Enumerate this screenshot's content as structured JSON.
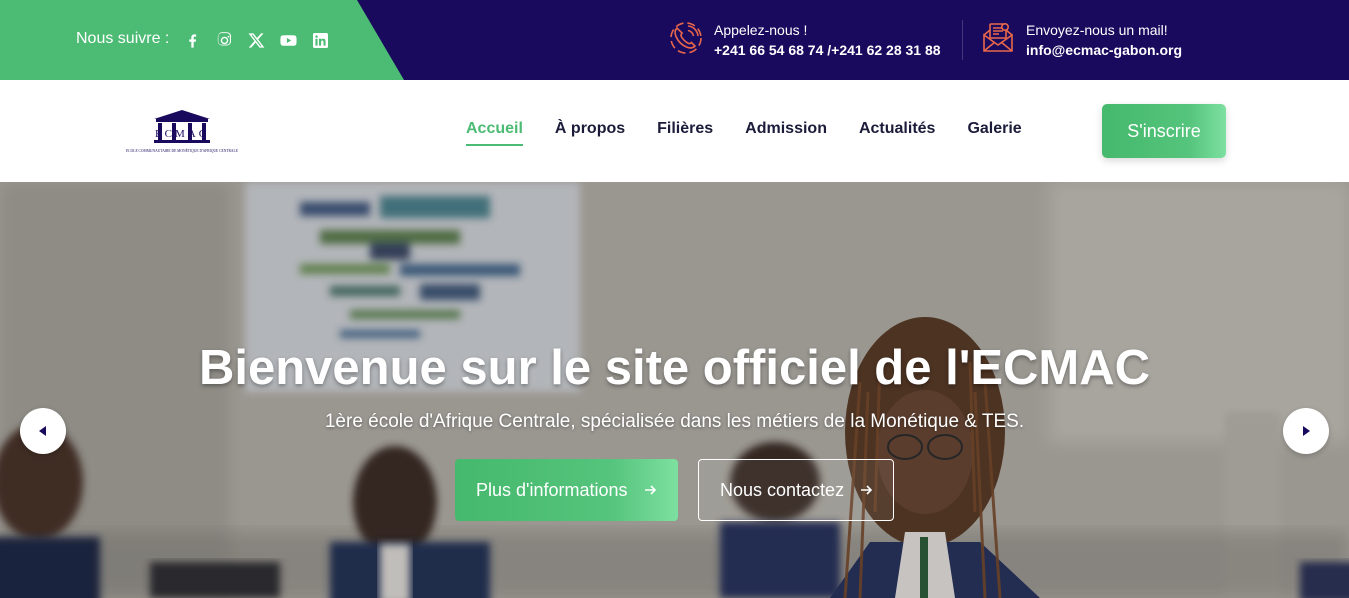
{
  "topbar": {
    "follow_label": "Nous suivre :",
    "socials": [
      {
        "icon": "facebook-icon"
      },
      {
        "icon": "instagram-icon"
      },
      {
        "icon": "x-twitter-icon"
      },
      {
        "icon": "youtube-icon"
      },
      {
        "icon": "linkedin-icon"
      }
    ],
    "phone": {
      "title": "Appelez-nous !",
      "value": "+241 66 54 68 74 /+241 62 28 31 88",
      "icon": "phone-icon"
    },
    "mail": {
      "title": "Envoyez-nous un mail!",
      "value": "info@ecmac-gabon.org",
      "icon": "mail-icon"
    }
  },
  "header": {
    "logo_text": "ECMAC",
    "logo_subtitle": "ECOLE COMMUNAUTAIRE DE MONÉTIQUE D'AFRIQUE CENTRALE",
    "nav": [
      {
        "label": "Accueil",
        "active": true
      },
      {
        "label": "À propos",
        "active": false
      },
      {
        "label": "Filières",
        "active": false
      },
      {
        "label": "Admission",
        "active": false
      },
      {
        "label": "Actualités",
        "active": false
      },
      {
        "label": "Galerie",
        "active": false
      }
    ],
    "signup_label": "S'inscrire"
  },
  "hero": {
    "title": "Bienvenue sur le site officiel de l'ECMAC",
    "subtitle": "1ère école d'Afrique Centrale, spécialisée dans les métiers de la Monétique & TES.",
    "primary_button": "Plus d'informations",
    "secondary_button": "Nous contactez"
  },
  "colors": {
    "green": "#4cbb74",
    "navy": "#1a0a5e",
    "icon_orange": "#e8674a"
  }
}
